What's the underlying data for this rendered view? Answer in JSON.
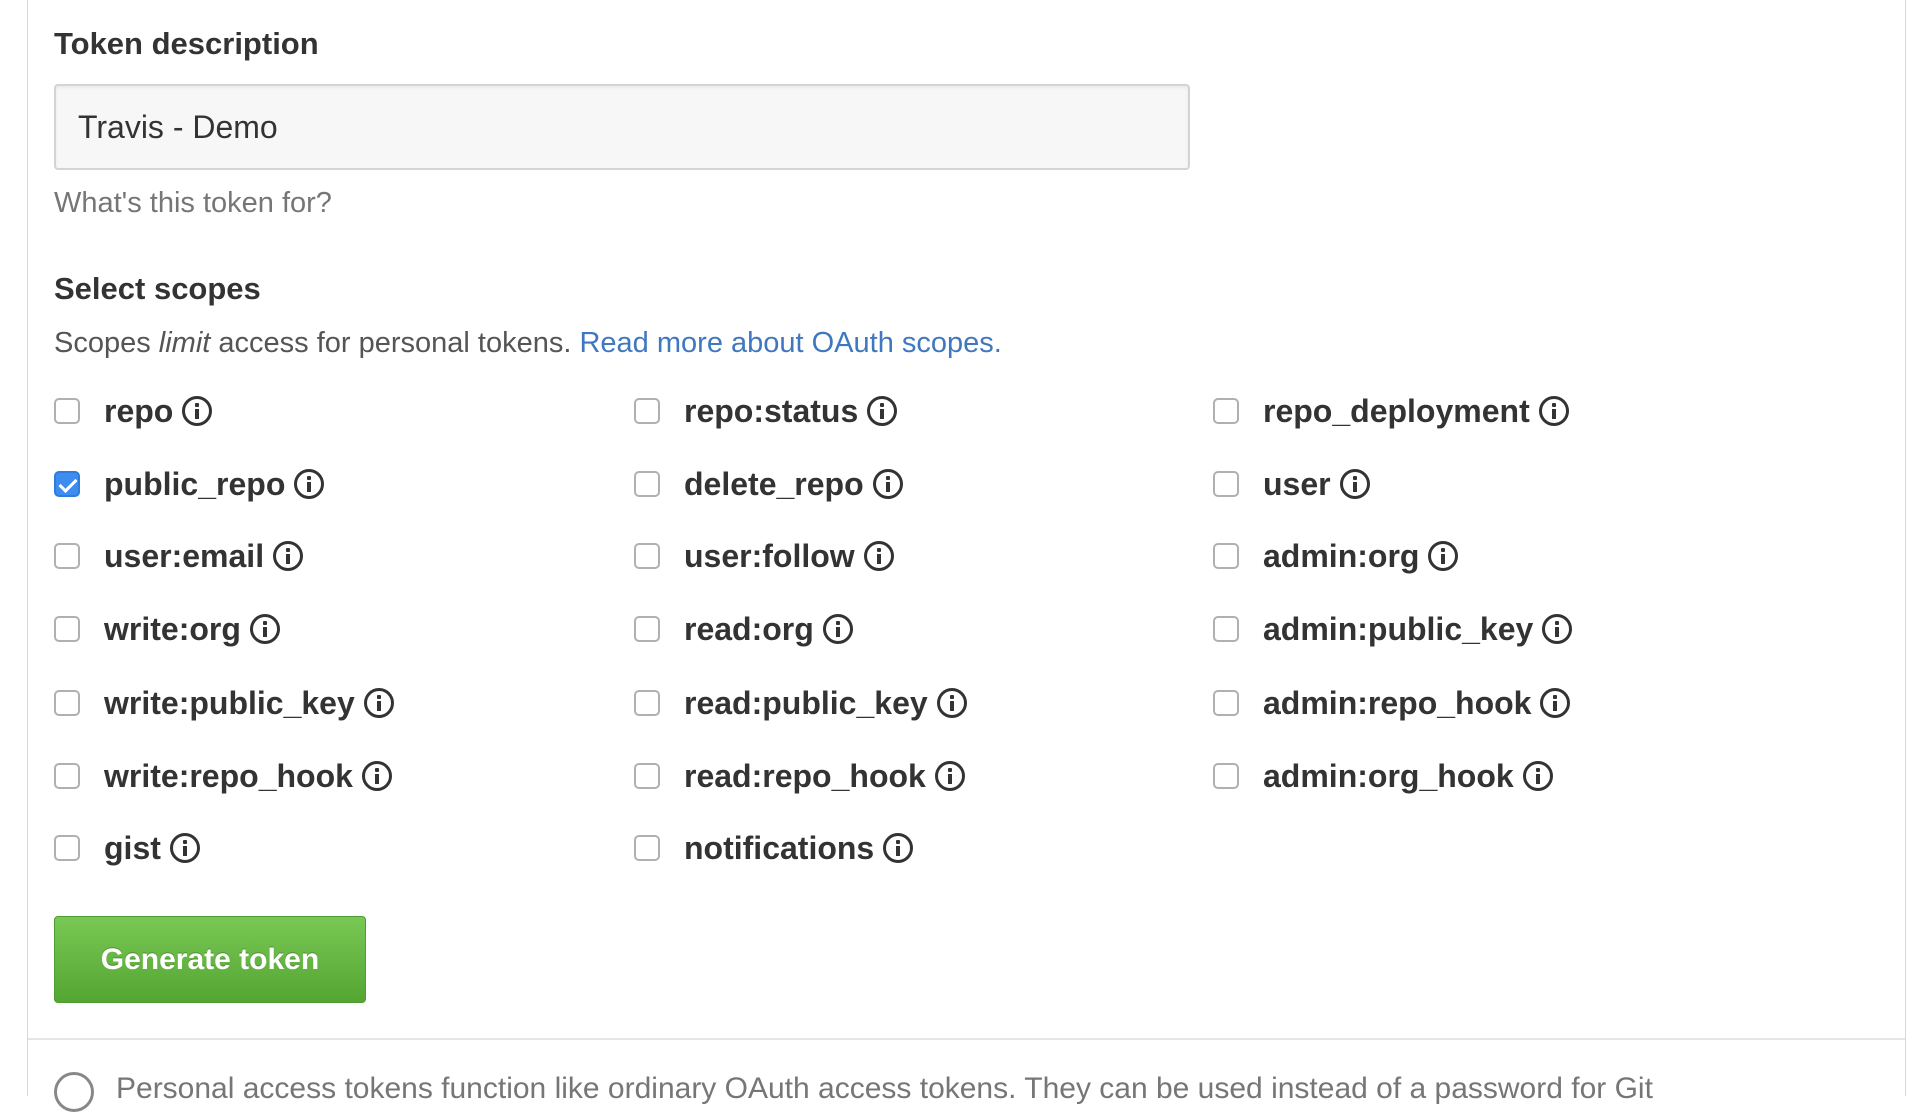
{
  "token": {
    "label": "Token description",
    "value": "Travis - Demo",
    "note": "What's this token for?"
  },
  "scopes": {
    "heading": "Select scopes",
    "desc_prefix": "Scopes ",
    "desc_em": "limit",
    "desc_suffix": " access for personal tokens. ",
    "link_text": "Read more about OAuth scopes.",
    "columns": [
      [
        {
          "name": "repo",
          "checked": false
        },
        {
          "name": "public_repo",
          "checked": true
        },
        {
          "name": "user:email",
          "checked": false
        },
        {
          "name": "write:org",
          "checked": false
        },
        {
          "name": "write:public_key",
          "checked": false
        },
        {
          "name": "write:repo_hook",
          "checked": false
        },
        {
          "name": "gist",
          "checked": false
        }
      ],
      [
        {
          "name": "repo:status",
          "checked": false
        },
        {
          "name": "delete_repo",
          "checked": false
        },
        {
          "name": "user:follow",
          "checked": false
        },
        {
          "name": "read:org",
          "checked": false
        },
        {
          "name": "read:public_key",
          "checked": false
        },
        {
          "name": "read:repo_hook",
          "checked": false
        },
        {
          "name": "notifications",
          "checked": false
        }
      ],
      [
        {
          "name": "repo_deployment",
          "checked": false
        },
        {
          "name": "user",
          "checked": false
        },
        {
          "name": "admin:org",
          "checked": false
        },
        {
          "name": "admin:public_key",
          "checked": false
        },
        {
          "name": "admin:repo_hook",
          "checked": false
        },
        {
          "name": "admin:org_hook",
          "checked": false
        }
      ]
    ]
  },
  "button": {
    "label": "Generate token"
  },
  "footer": {
    "text": "Personal access tokens function like ordinary OAuth access tokens. They can be used instead of a password for Git"
  },
  "colors": {
    "link": "#4078c0",
    "button_green": "#55a532",
    "checkbox_checked": "#3d8cf0"
  }
}
